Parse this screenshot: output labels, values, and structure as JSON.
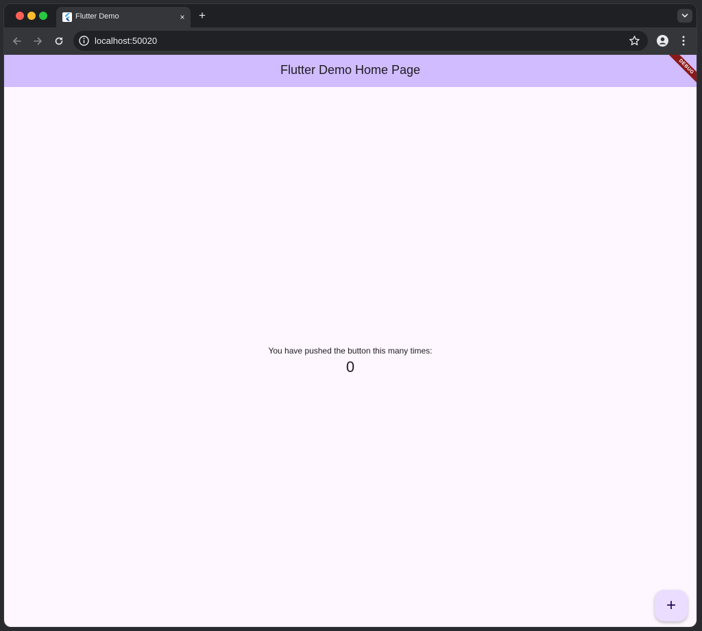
{
  "browser": {
    "tab": {
      "title": "Flutter Demo",
      "favicon": "flutter-icon",
      "close_icon": "×"
    },
    "new_tab_icon": "+",
    "url": "localhost:50020"
  },
  "app": {
    "appbar_title": "Flutter Demo Home Page",
    "debug_banner": "DEBUG",
    "counter_label": "You have pushed the button this many times:",
    "counter_value": "0",
    "fab_icon": "+"
  },
  "colors": {
    "appbar": "#d0bcff",
    "page_background": "#fef7ff",
    "fab": "#eaddff",
    "debug_banner": "#8b1a1a"
  }
}
